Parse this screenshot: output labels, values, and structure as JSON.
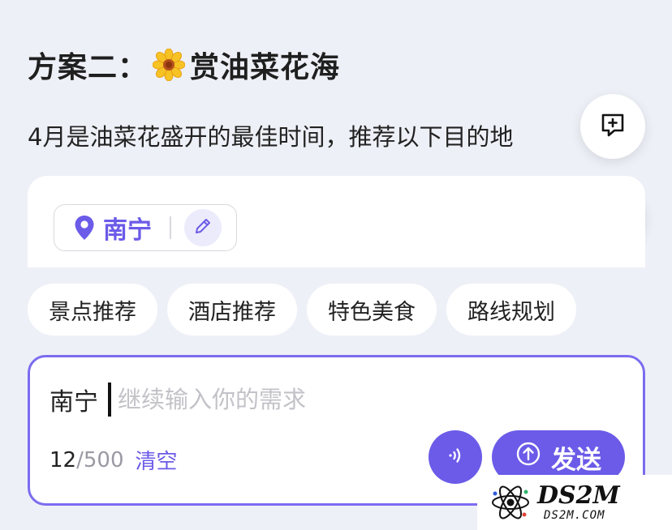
{
  "heading": {
    "prefix": "方案二：",
    "flower_icon": "sunflower-icon",
    "title": "赏油菜花海"
  },
  "description": "4月是油菜花盛开的最佳时间，推荐以下目的地",
  "floating_actions": {
    "comment_icon": "comment-plus-icon",
    "download_icon": "download-icon"
  },
  "destination": {
    "location_icon": "location-pin-icon",
    "name": "南宁",
    "edit_icon": "pencil-icon"
  },
  "chips": [
    {
      "label": "景点推荐"
    },
    {
      "label": "酒店推荐"
    },
    {
      "label": "特色美食"
    },
    {
      "label": "路线规划"
    }
  ],
  "input": {
    "prefix": "南宁",
    "placeholder": "继续输入你的需求",
    "value": "",
    "count_current": "12",
    "count_max": "/500",
    "clear_label": "清空",
    "voice_icon": "voice-wave-icon",
    "send_icon": "arrow-up-circle-icon",
    "send_label": "发送"
  },
  "watermark": {
    "title": "DS2M",
    "subtitle": "DS2M.COM"
  },
  "colors": {
    "accent": "#6b5be8",
    "background": "#eef0f7",
    "input_border": "#7b6cf0"
  }
}
